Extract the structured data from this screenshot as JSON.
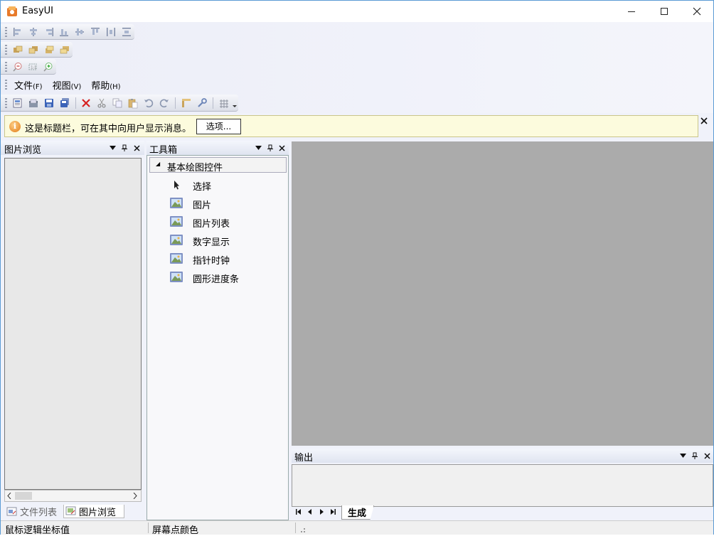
{
  "window": {
    "title": "EasyUI"
  },
  "menu": [
    {
      "label": "文件",
      "key": "(F)"
    },
    {
      "label": "视图",
      "key": "(V)"
    },
    {
      "label": "帮助",
      "key": "(H)"
    }
  ],
  "infobar": {
    "message": "这是标题栏，可在其中向用户显示消息。",
    "options_button": "选项..."
  },
  "left_panel": {
    "title": "图片浏览",
    "tabs": [
      "文件列表",
      "图片浏览"
    ]
  },
  "toolbox": {
    "title": "工具箱",
    "category": "基本绘图控件",
    "items": [
      "选择",
      "图片",
      "图片列表",
      "数字显示",
      "指针时钟",
      "圆形进度条"
    ]
  },
  "output": {
    "title": "输出",
    "tab": "生成"
  },
  "statusbar": {
    "mouse_coord": "鼠标逻辑坐标值",
    "screen_color": "屏幕点颜色"
  },
  "colors": {
    "doc_background": "#ababab",
    "infobar_background": "#fcfbdd",
    "window_border": "#5b9bd5"
  }
}
